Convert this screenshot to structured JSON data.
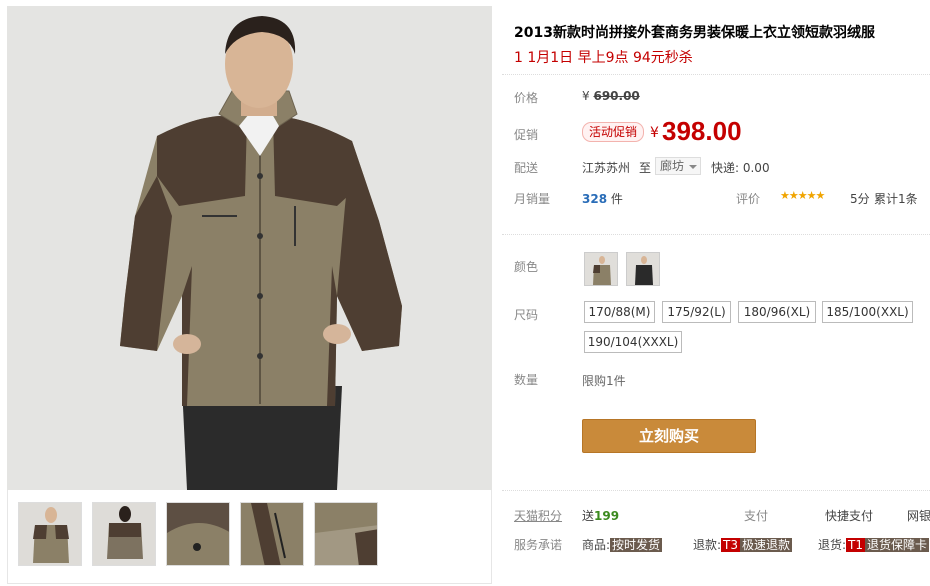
{
  "product": {
    "title": "2013新款时尚拼接外套商务男装保暖上衣立领短款羽绒服",
    "subtitle": "1 1月1日 早上9点 94元秒杀"
  },
  "price": {
    "label": "价格",
    "currency": "¥",
    "original": "690.00"
  },
  "promo": {
    "label": "促销",
    "badge": "活动促销",
    "currency": "¥",
    "price": "398.00"
  },
  "shipping": {
    "label": "配送",
    "from": "江苏苏州",
    "to_label": "至",
    "destination": "廊坊",
    "express": "快递: 0.00"
  },
  "sales": {
    "label": "月销量",
    "count": "328",
    "unit": "件",
    "rating_label": "评价",
    "stars": "★★★★★",
    "score": "5分",
    "reviews": "累计1条"
  },
  "color": {
    "label": "颜色"
  },
  "size": {
    "label": "尺码",
    "options": [
      "170/88(M)",
      "175/92(L)",
      "180/96(XL)",
      "185/100(XXL)",
      "190/104(XXXL)"
    ]
  },
  "quantity": {
    "label": "数量",
    "limit": "限购1件"
  },
  "buy": {
    "label": "立刻购买"
  },
  "points": {
    "label": "天猫积分",
    "send": "送",
    "value": "199",
    "payment_label": "支付",
    "quick_pay": "快捷支付",
    "bank": "网银"
  },
  "service": {
    "label": "服务承诺",
    "goods": "商品:",
    "goods_tag": "按时发货",
    "refund": "退款:",
    "refund_tag_t": "T3",
    "refund_tag": "极速退款",
    "return": "退货:",
    "return_tag_t": "T1",
    "return_tag": "退货保障卡"
  },
  "colors": {
    "price_red": "#c40000",
    "buy_button": "#c98a3a",
    "star": "#f0a400",
    "link_blue": "#2a6db8"
  }
}
